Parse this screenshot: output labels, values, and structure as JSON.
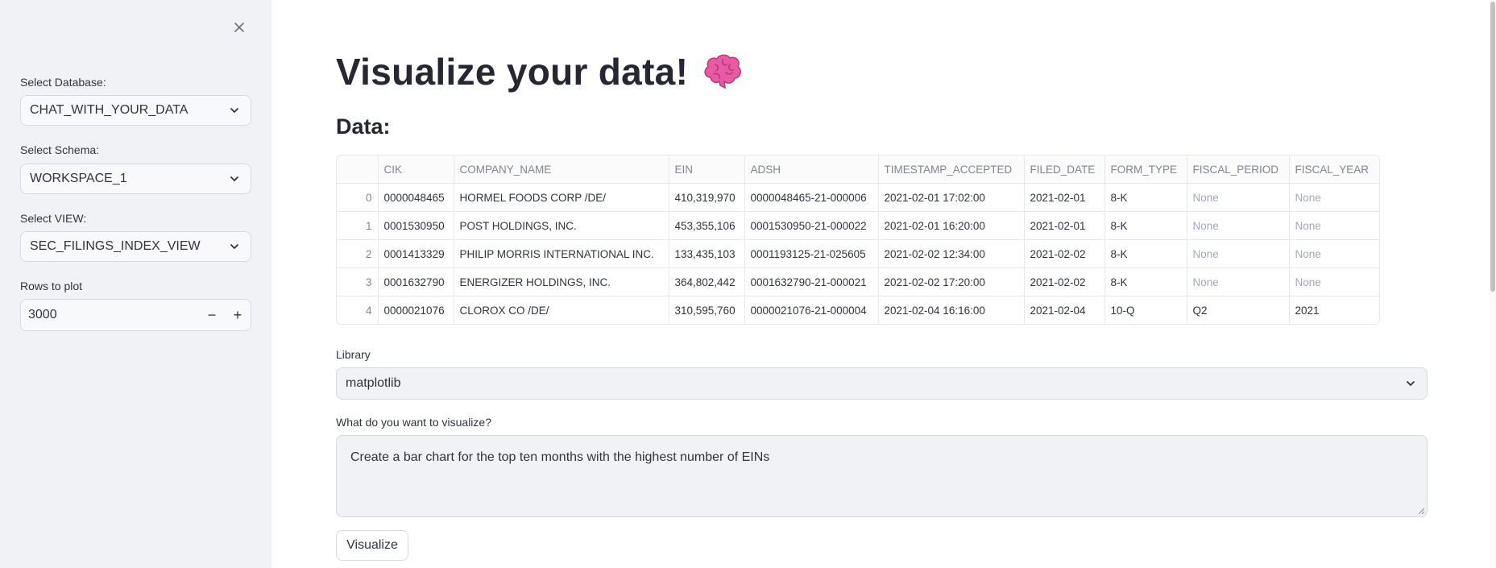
{
  "sidebar": {
    "database_label": "Select Database:",
    "database_value": "CHAT_WITH_YOUR_DATA",
    "schema_label": "Select Schema:",
    "schema_value": "WORKSPACE_1",
    "view_label": "Select VIEW:",
    "view_value": "SEC_FILINGS_INDEX_VIEW",
    "rows_label": "Rows to plot",
    "rows_value": "3000",
    "minus": "−",
    "plus": "+"
  },
  "main": {
    "title": "Visualize your data!",
    "title_emoji": "brain-icon",
    "data_heading": "Data:",
    "table": {
      "columns": [
        "",
        "CIK",
        "COMPANY_NAME",
        "EIN",
        "ADSH",
        "TIMESTAMP_ACCEPTED",
        "FILED_DATE",
        "FORM_TYPE",
        "FISCAL_PERIOD",
        "FISCAL_YEAR"
      ],
      "rows": [
        [
          "0",
          "0000048465",
          "HORMEL FOODS CORP /DE/",
          "410,319,970",
          "0000048465-21-000006",
          "2021-02-01 17:02:00",
          "2021-02-01",
          "8-K",
          "None",
          "None"
        ],
        [
          "1",
          "0001530950",
          "POST HOLDINGS, INC.",
          "453,355,106",
          "0001530950-21-000022",
          "2021-02-01 16:20:00",
          "2021-02-01",
          "8-K",
          "None",
          "None"
        ],
        [
          "2",
          "0001413329",
          "PHILIP MORRIS INTERNATIONAL INC.",
          "133,435,103",
          "0001193125-21-025605",
          "2021-02-02 12:34:00",
          "2021-02-02",
          "8-K",
          "None",
          "None"
        ],
        [
          "3",
          "0001632790",
          "ENERGIZER HOLDINGS, INC.",
          "364,802,442",
          "0001632790-21-000021",
          "2021-02-02 17:20:00",
          "2021-02-02",
          "8-K",
          "None",
          "None"
        ],
        [
          "4",
          "0000021076",
          "CLOROX CO /DE/",
          "310,595,760",
          "0000021076-21-000004",
          "2021-02-04 16:16:00",
          "2021-02-04",
          "10-Q",
          "Q2",
          "2021"
        ]
      ]
    },
    "library_label": "Library",
    "library_value": "matplotlib",
    "prompt_label": "What do you want to visualize?",
    "prompt_value": "Create a bar chart for the top ten months with the highest number of EINs",
    "visualize_button": "Visualize"
  },
  "colors": {
    "sidebar_bg": "#f0f2f6",
    "text": "#31333f",
    "muted": "#808495",
    "brain": "#e85aa4"
  }
}
